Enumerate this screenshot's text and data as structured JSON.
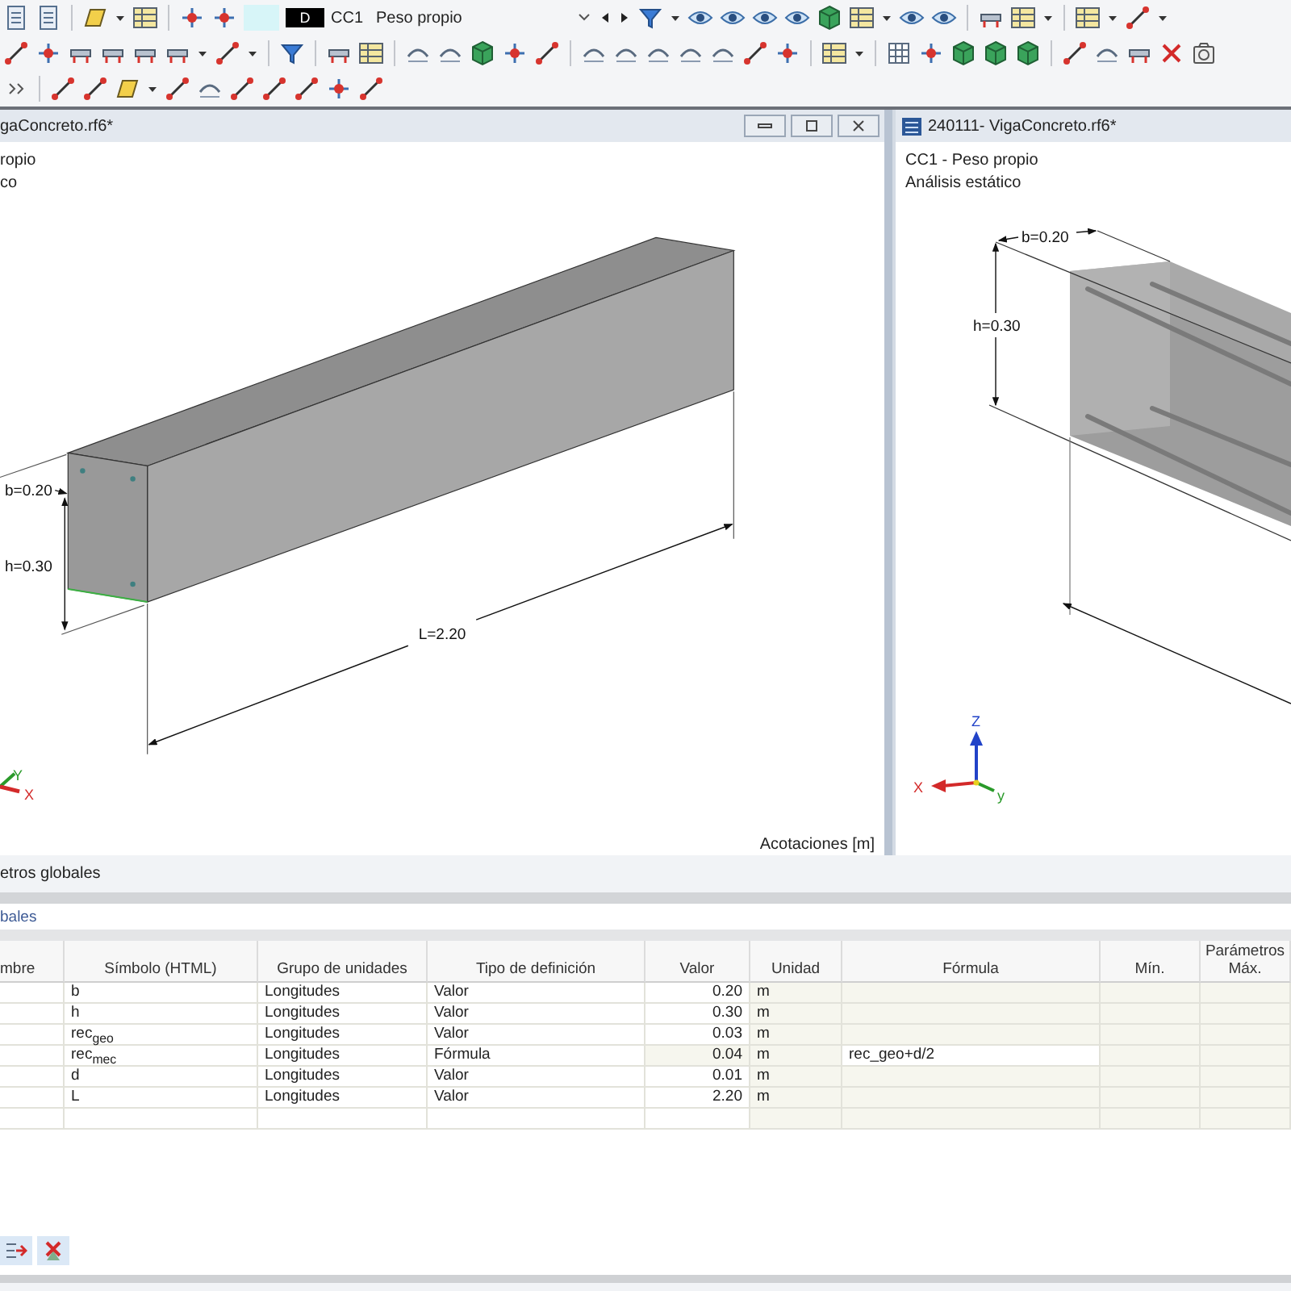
{
  "toolbar": {
    "load_case": {
      "badge": "D",
      "code": "CC1",
      "name": "Peso propio"
    }
  },
  "left_view": {
    "title": "gaConcreto.rf6*",
    "info": [
      "ropio",
      "co"
    ],
    "labels": {
      "b": "b=0.20",
      "h": "h=0.30",
      "L": "L=2.20"
    },
    "axes": {
      "y": "Y",
      "x": "X"
    },
    "footer": "Acotaciones [m]"
  },
  "right_view": {
    "title": "240111- VigaConcreto.rf6*",
    "info": [
      "CC1 - Peso propio",
      "Análisis estático"
    ],
    "labels": {
      "b": "b=0.20",
      "h": "h=0.30"
    },
    "axes": {
      "z": "Z",
      "x": "X",
      "y": "y"
    }
  },
  "bottom_panel": {
    "title": "etros globales",
    "subtitle": "bales",
    "column_group": "Parámetros",
    "columns": [
      "mbre",
      "Símbolo (HTML)",
      "Grupo de unidades",
      "Tipo de definición",
      "Valor",
      "Unidad",
      "Fórmula",
      "Mín.",
      "Máx."
    ],
    "rows": [
      {
        "kind": "value",
        "symbol": "b",
        "group": "Longitudes",
        "definition": "Valor",
        "value": "0.20",
        "unit": "m"
      },
      {
        "kind": "value",
        "symbol": "h",
        "group": "Longitudes",
        "definition": "Valor",
        "value": "0.30",
        "unit": "m"
      },
      {
        "kind": "value",
        "symbol": "rec$_{geo}$",
        "group": "Longitudes",
        "definition": "Valor",
        "value": "0.03",
        "unit": "m"
      },
      {
        "kind": "formula",
        "symbol": "rec$_{mec}$",
        "group": "Longitudes",
        "definition": "Fórmula",
        "value": "0.04",
        "unit": "m",
        "formula": "rec_geo+d/2"
      },
      {
        "kind": "value",
        "symbol": "d",
        "group": "Longitudes",
        "definition": "Valor",
        "value": "0.01",
        "unit": "m"
      },
      {
        "kind": "value",
        "symbol": "L",
        "group": "Longitudes",
        "definition": "Valor",
        "value": "2.20",
        "unit": "m"
      }
    ]
  }
}
